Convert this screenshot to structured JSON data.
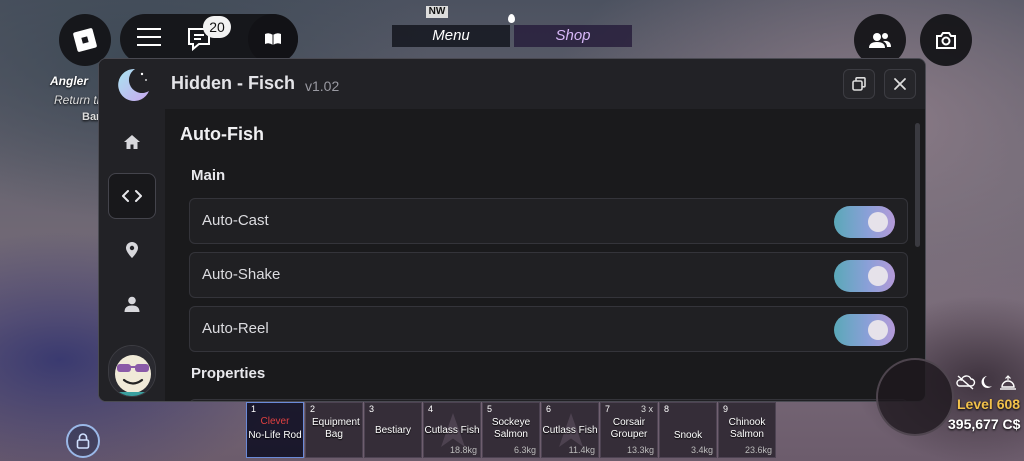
{
  "hud": {
    "notification_count": "20",
    "angler_title": "Angler",
    "angler_subtitle": "Return the",
    "angler_target": "Barracuda",
    "compass_label": "NW",
    "top_tabs": [
      {
        "label": "Menu"
      },
      {
        "label": "Shop"
      }
    ]
  },
  "window": {
    "title": "Hidden - Fisch",
    "version": "v1.02",
    "icons": {
      "logo": "crescent-moon-icon",
      "restore": "restore-window-icon",
      "close": "close-icon"
    }
  },
  "sidebar": {
    "items": [
      {
        "icon": "home-icon"
      },
      {
        "icon": "code-icon",
        "active": true
      },
      {
        "icon": "location-pin-icon"
      },
      {
        "icon": "user-icon"
      }
    ]
  },
  "content": {
    "section_title": "Auto-Fish",
    "main_label": "Main",
    "toggles": [
      {
        "label": "Auto-Cast",
        "on": true
      },
      {
        "label": "Auto-Shake",
        "on": true
      },
      {
        "label": "Auto-Reel",
        "on": true
      }
    ],
    "properties_label": "Properties"
  },
  "hotbar": [
    {
      "num": "1",
      "tag": "Clever",
      "name": "No-Life Rod",
      "weight": "",
      "qty": "",
      "selected": true
    },
    {
      "num": "2",
      "tag": "",
      "name": "Equipment Bag",
      "weight": "",
      "qty": ""
    },
    {
      "num": "3",
      "tag": "",
      "name": "Bestiary",
      "weight": "",
      "qty": ""
    },
    {
      "num": "4",
      "tag": "",
      "name": "Cutlass Fish",
      "weight": "18.8kg",
      "qty": ""
    },
    {
      "num": "5",
      "tag": "",
      "name": "Sockeye Salmon",
      "weight": "6.3kg",
      "qty": ""
    },
    {
      "num": "6",
      "tag": "",
      "name": "Cutlass Fish",
      "weight": "11.4kg",
      "qty": ""
    },
    {
      "num": "7",
      "tag": "",
      "name": "Corsair Grouper",
      "weight": "13.3kg",
      "qty": "3 x"
    },
    {
      "num": "8",
      "tag": "",
      "name": "Snook",
      "weight": "3.4kg",
      "qty": ""
    },
    {
      "num": "9",
      "tag": "",
      "name": "Chinook Salmon",
      "weight": "23.6kg",
      "qty": ""
    }
  ],
  "stats": {
    "level": "Level 608",
    "coins": "395,677 C$"
  },
  "colors": {
    "toggle_gradient_start": "#5aa8b8",
    "toggle_gradient_end": "#b49ad8",
    "level_color": "#f2c14a"
  }
}
